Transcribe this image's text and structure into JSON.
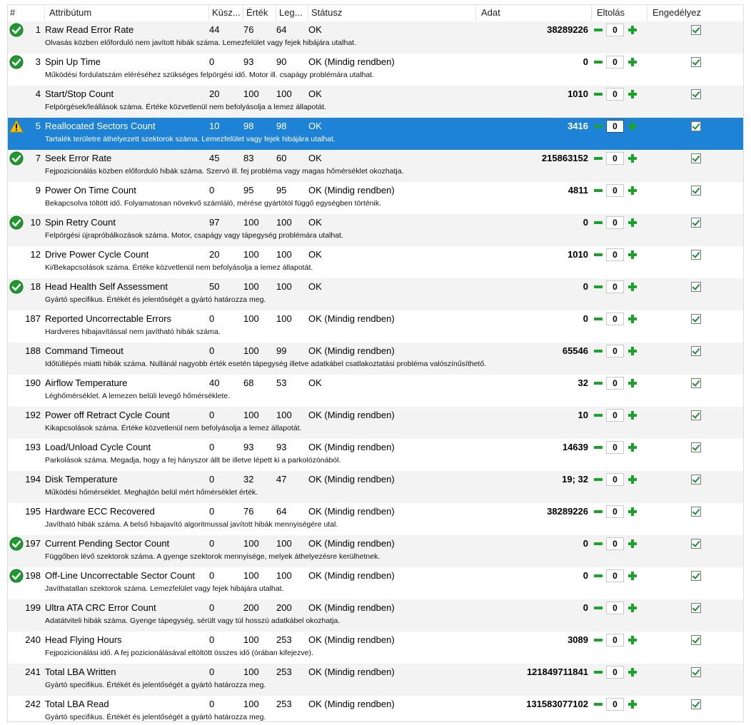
{
  "columns": {
    "num": "#",
    "attr": "Attribútum",
    "thr": "Küsz...",
    "val": "Érték",
    "worst": "Leg...",
    "status": "Státusz",
    "raw": "Adat",
    "offset": "Eltolás",
    "enable": "Engedélyez"
  },
  "rows": [
    {
      "num": "1",
      "attr": "Raw Read Error Rate",
      "thr": "44",
      "val": "76",
      "worst": "64",
      "status": "OK",
      "raw": "38289226",
      "offset": "0",
      "desc": "Olvasás közben előforduló nem javított hibák száma. Lemezfelület vagy fejek hibájára utalhat.",
      "icon": "check",
      "sel": false
    },
    {
      "num": "3",
      "attr": "Spin Up Time",
      "thr": "0",
      "val": "93",
      "worst": "90",
      "status": "OK (Mindig rendben)",
      "raw": "0",
      "offset": "0",
      "desc": "Működési fordulatszám eléréséhez szükséges felpörgési idő. Motor ill. csapágy problémára utalhat.",
      "icon": "check",
      "sel": false
    },
    {
      "num": "4",
      "attr": "Start/Stop Count",
      "thr": "20",
      "val": "100",
      "worst": "100",
      "status": "OK",
      "raw": "1010",
      "offset": "0",
      "desc": "Felpörgések/leállások száma. Értéke közvetlenül nem befolyásolja a lemez állapotát.",
      "icon": "",
      "sel": false
    },
    {
      "num": "5",
      "attr": "Reallocated Sectors Count",
      "thr": "10",
      "val": "98",
      "worst": "98",
      "status": "OK",
      "raw": "3416",
      "offset": "0",
      "desc": "Tartalék területre áthelyezett szektorok száma. Lemezfelület vagy fejek hibájára utalhat.",
      "icon": "warn",
      "sel": true
    },
    {
      "num": "7",
      "attr": "Seek Error Rate",
      "thr": "45",
      "val": "83",
      "worst": "60",
      "status": "OK",
      "raw": "215863152",
      "offset": "0",
      "desc": "Fejpozicionálás közben előforduló hibák száma. Szervó ill. fej probléma vagy magas hőmérséklet okozhatja.",
      "icon": "check",
      "sel": false
    },
    {
      "num": "9",
      "attr": "Power On Time Count",
      "thr": "0",
      "val": "95",
      "worst": "95",
      "status": "OK (Mindig rendben)",
      "raw": "4811",
      "offset": "0",
      "desc": "Bekapcsolva töltött idő. Folyamatosan növekvő számláló, mérése gyártótól függő egységben történik.",
      "icon": "",
      "sel": false
    },
    {
      "num": "10",
      "attr": "Spin Retry Count",
      "thr": "97",
      "val": "100",
      "worst": "100",
      "status": "OK",
      "raw": "0",
      "offset": "0",
      "desc": "Felpörgési újrapróbálkozások száma. Motor, csapágy vagy tápegység problémára utalhat.",
      "icon": "check",
      "sel": false
    },
    {
      "num": "12",
      "attr": "Drive Power Cycle Count",
      "thr": "20",
      "val": "100",
      "worst": "100",
      "status": "OK",
      "raw": "1010",
      "offset": "0",
      "desc": "Ki/Bekapcsolások száma. Értéke közvetlenül nem befolyásolja a lemez állapotát.",
      "icon": "",
      "sel": false
    },
    {
      "num": "18",
      "attr": "Head Health Self Assessment",
      "thr": "50",
      "val": "100",
      "worst": "100",
      "status": "OK",
      "raw": "0",
      "offset": "0",
      "desc": "Gyártó specifikus. Értékét és jelentőségét a gyártó határozza meg.",
      "icon": "check",
      "sel": false
    },
    {
      "num": "187",
      "attr": "Reported Uncorrectable Errors",
      "thr": "0",
      "val": "100",
      "worst": "100",
      "status": "OK (Mindig rendben)",
      "raw": "0",
      "offset": "0",
      "desc": "Hardveres hibajavítással nem javítható hibák száma.",
      "icon": "",
      "sel": false
    },
    {
      "num": "188",
      "attr": "Command Timeout",
      "thr": "0",
      "val": "100",
      "worst": "99",
      "status": "OK (Mindig rendben)",
      "raw": "65546",
      "offset": "0",
      "desc": "Időtúllépés miatti hibák száma. Nullánál nagyobb érték esetén tápegység illetve adatkábel csatlakoztatási probléma valószínűsíthető.",
      "icon": "",
      "sel": false
    },
    {
      "num": "190",
      "attr": "Airflow Temperature",
      "thr": "40",
      "val": "68",
      "worst": "53",
      "status": "OK",
      "raw": "32",
      "offset": "0",
      "desc": "Léghőmérséklet. A lemezen belüli levegő hőmérséklete.",
      "icon": "",
      "sel": false
    },
    {
      "num": "192",
      "attr": "Power off Retract Cycle Count",
      "thr": "0",
      "val": "100",
      "worst": "100",
      "status": "OK (Mindig rendben)",
      "raw": "10",
      "offset": "0",
      "desc": "Kikapcsolások száma. Értéke közvetlenül nem befolyásolja a lemez állapotát.",
      "icon": "",
      "sel": false
    },
    {
      "num": "193",
      "attr": "Load/Unload Cycle Count",
      "thr": "0",
      "val": "93",
      "worst": "93",
      "status": "OK (Mindig rendben)",
      "raw": "14639",
      "offset": "0",
      "desc": "Parkolások száma. Megadja, hogy a fej hányszor állt be illetve lépett ki a parkolózónából.",
      "icon": "",
      "sel": false
    },
    {
      "num": "194",
      "attr": "Disk Temperature",
      "thr": "0",
      "val": "32",
      "worst": "47",
      "status": "OK (Mindig rendben)",
      "raw": "19; 32",
      "offset": "0",
      "desc": "Működési hőmérséklet. Meghajtón belül mért hőmérséklet érték.",
      "icon": "",
      "sel": false
    },
    {
      "num": "195",
      "attr": "Hardware ECC Recovered",
      "thr": "0",
      "val": "76",
      "worst": "64",
      "status": "OK (Mindig rendben)",
      "raw": "38289226",
      "offset": "0",
      "desc": "Javítható hibák száma. A belső hibajavító algoritmussal javított hibák mennyiségére utal.",
      "icon": "",
      "sel": false
    },
    {
      "num": "197",
      "attr": "Current Pending Sector Count",
      "thr": "0",
      "val": "100",
      "worst": "100",
      "status": "OK (Mindig rendben)",
      "raw": "0",
      "offset": "0",
      "desc": "Függőben lévő szektorok száma. A gyenge szektorok mennyisége, melyek áthelyezésre kerülhetnek.",
      "icon": "check",
      "sel": false
    },
    {
      "num": "198",
      "attr": "Off-Line Uncorrectable Sector Count",
      "thr": "0",
      "val": "100",
      "worst": "100",
      "status": "OK (Mindig rendben)",
      "raw": "0",
      "offset": "0",
      "desc": "Javíthatatlan szektorok száma. Lemezfelület vagy fejek hibájára utalhat.",
      "icon": "check",
      "sel": false
    },
    {
      "num": "199",
      "attr": "Ultra ATA CRC Error Count",
      "thr": "0",
      "val": "200",
      "worst": "200",
      "status": "OK (Mindig rendben)",
      "raw": "0",
      "offset": "0",
      "desc": "Adatátviteli hibák száma. Gyenge tápegység, sérült vagy túl hosszú adatkábel okozhatja.",
      "icon": "",
      "sel": false
    },
    {
      "num": "240",
      "attr": "Head Flying Hours",
      "thr": "0",
      "val": "100",
      "worst": "253",
      "status": "OK (Mindig rendben)",
      "raw": "3089",
      "offset": "0",
      "desc": "Fejpozicionálási idő. A fej pozicionálásával eltöltött összes idő (órában kifejezve).",
      "icon": "",
      "sel": false
    },
    {
      "num": "241",
      "attr": "Total LBA Written",
      "thr": "0",
      "val": "100",
      "worst": "253",
      "status": "OK (Mindig rendben)",
      "raw": "121849711841",
      "offset": "0",
      "desc": "Gyártó specifikus. Értékét és jelentőségét a gyártó határozza meg.",
      "icon": "",
      "sel": false
    },
    {
      "num": "242",
      "attr": "Total LBA Read",
      "thr": "0",
      "val": "100",
      "worst": "253",
      "status": "OK (Mindig rendben)",
      "raw": "131583077102",
      "offset": "0",
      "desc": "Gyártó specifikus. Értékét és jelentőségét a gyártó határozza meg.",
      "icon": "",
      "sel": false
    }
  ]
}
